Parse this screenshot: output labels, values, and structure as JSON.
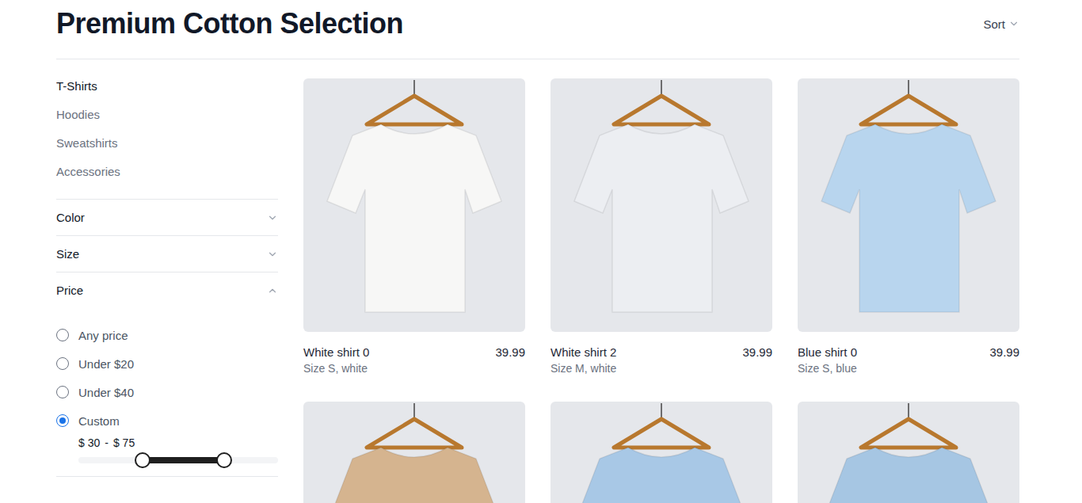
{
  "page": {
    "title": "Premium Cotton Selection",
    "sort": {
      "label": "Sort"
    }
  },
  "sidebar": {
    "categories": [
      {
        "label": "T-Shirts",
        "selected": true
      },
      {
        "label": "Hoodies",
        "selected": false
      },
      {
        "label": "Sweatshirts",
        "selected": false
      },
      {
        "label": "Accessories",
        "selected": false
      }
    ],
    "filters": [
      {
        "label": "Color",
        "expanded": false
      },
      {
        "label": "Size",
        "expanded": false
      },
      {
        "label": "Price",
        "expanded": true,
        "options": [
          {
            "label": "Any price",
            "selected": false
          },
          {
            "label": "Under $20",
            "selected": false
          },
          {
            "label": "Under $40",
            "selected": false
          },
          {
            "label": "Custom",
            "selected": true
          }
        ],
        "range": {
          "min_label": "$ 30",
          "separator": "-",
          "max_label": "$ 75",
          "level_start": 0.32,
          "level_end": 0.73
        }
      }
    ]
  },
  "products": [
    {
      "name": "White shirt 0",
      "details": "Size S, white",
      "price": "39.99",
      "color": "#f7f7f6"
    },
    {
      "name": "White shirt 2",
      "details": "Size M, white",
      "price": "39.99",
      "color": "#eceef2"
    },
    {
      "name": "Blue shirt 0",
      "details": "Size S, blue",
      "price": "39.99",
      "color": "#b8d5ee"
    },
    {
      "name": "",
      "details": "",
      "price": "",
      "color": "#d5b48f"
    },
    {
      "name": "",
      "details": "",
      "price": "",
      "color": "#a8c8e6"
    },
    {
      "name": "",
      "details": "",
      "price": "",
      "color": "#a6c6e3"
    }
  ]
}
